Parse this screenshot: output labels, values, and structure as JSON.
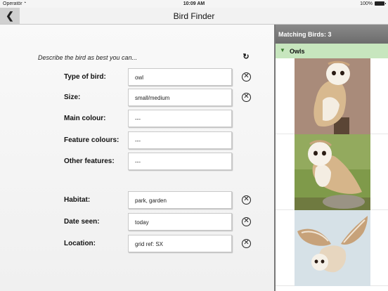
{
  "status_bar": {
    "carrier": "Operatör",
    "time": "10:09 AM",
    "battery": "100%"
  },
  "nav": {
    "title": "Bird Finder",
    "back_icon": "chevron-left-icon"
  },
  "form": {
    "prompt": "Describe the bird as best you can...",
    "refresh_icon": "refresh-icon",
    "fields": [
      {
        "label": "Type of bird:",
        "value": "owl",
        "clearable": true
      },
      {
        "label": "Size:",
        "value": "small/medium",
        "clearable": true
      },
      {
        "label": "Main colour:",
        "value": "---",
        "clearable": false
      },
      {
        "label": "Feature colours:",
        "value": "---",
        "clearable": false
      },
      {
        "label": "Other features:",
        "value": "---",
        "clearable": false
      },
      {
        "label": "Habitat:",
        "value": "park, garden",
        "clearable": true
      },
      {
        "label": "Date seen:",
        "value": "today",
        "clearable": true
      },
      {
        "label": "Location:",
        "value": "grid ref: SX",
        "clearable": true
      }
    ]
  },
  "results": {
    "header": "Matching Birds: 3",
    "group": "Owls",
    "group_color": "#c7e6be",
    "items": [
      {
        "image": "barn-owl-perched-photo"
      },
      {
        "image": "barn-owl-standing-photo"
      },
      {
        "image": "barn-owl-flying-photo"
      }
    ]
  }
}
